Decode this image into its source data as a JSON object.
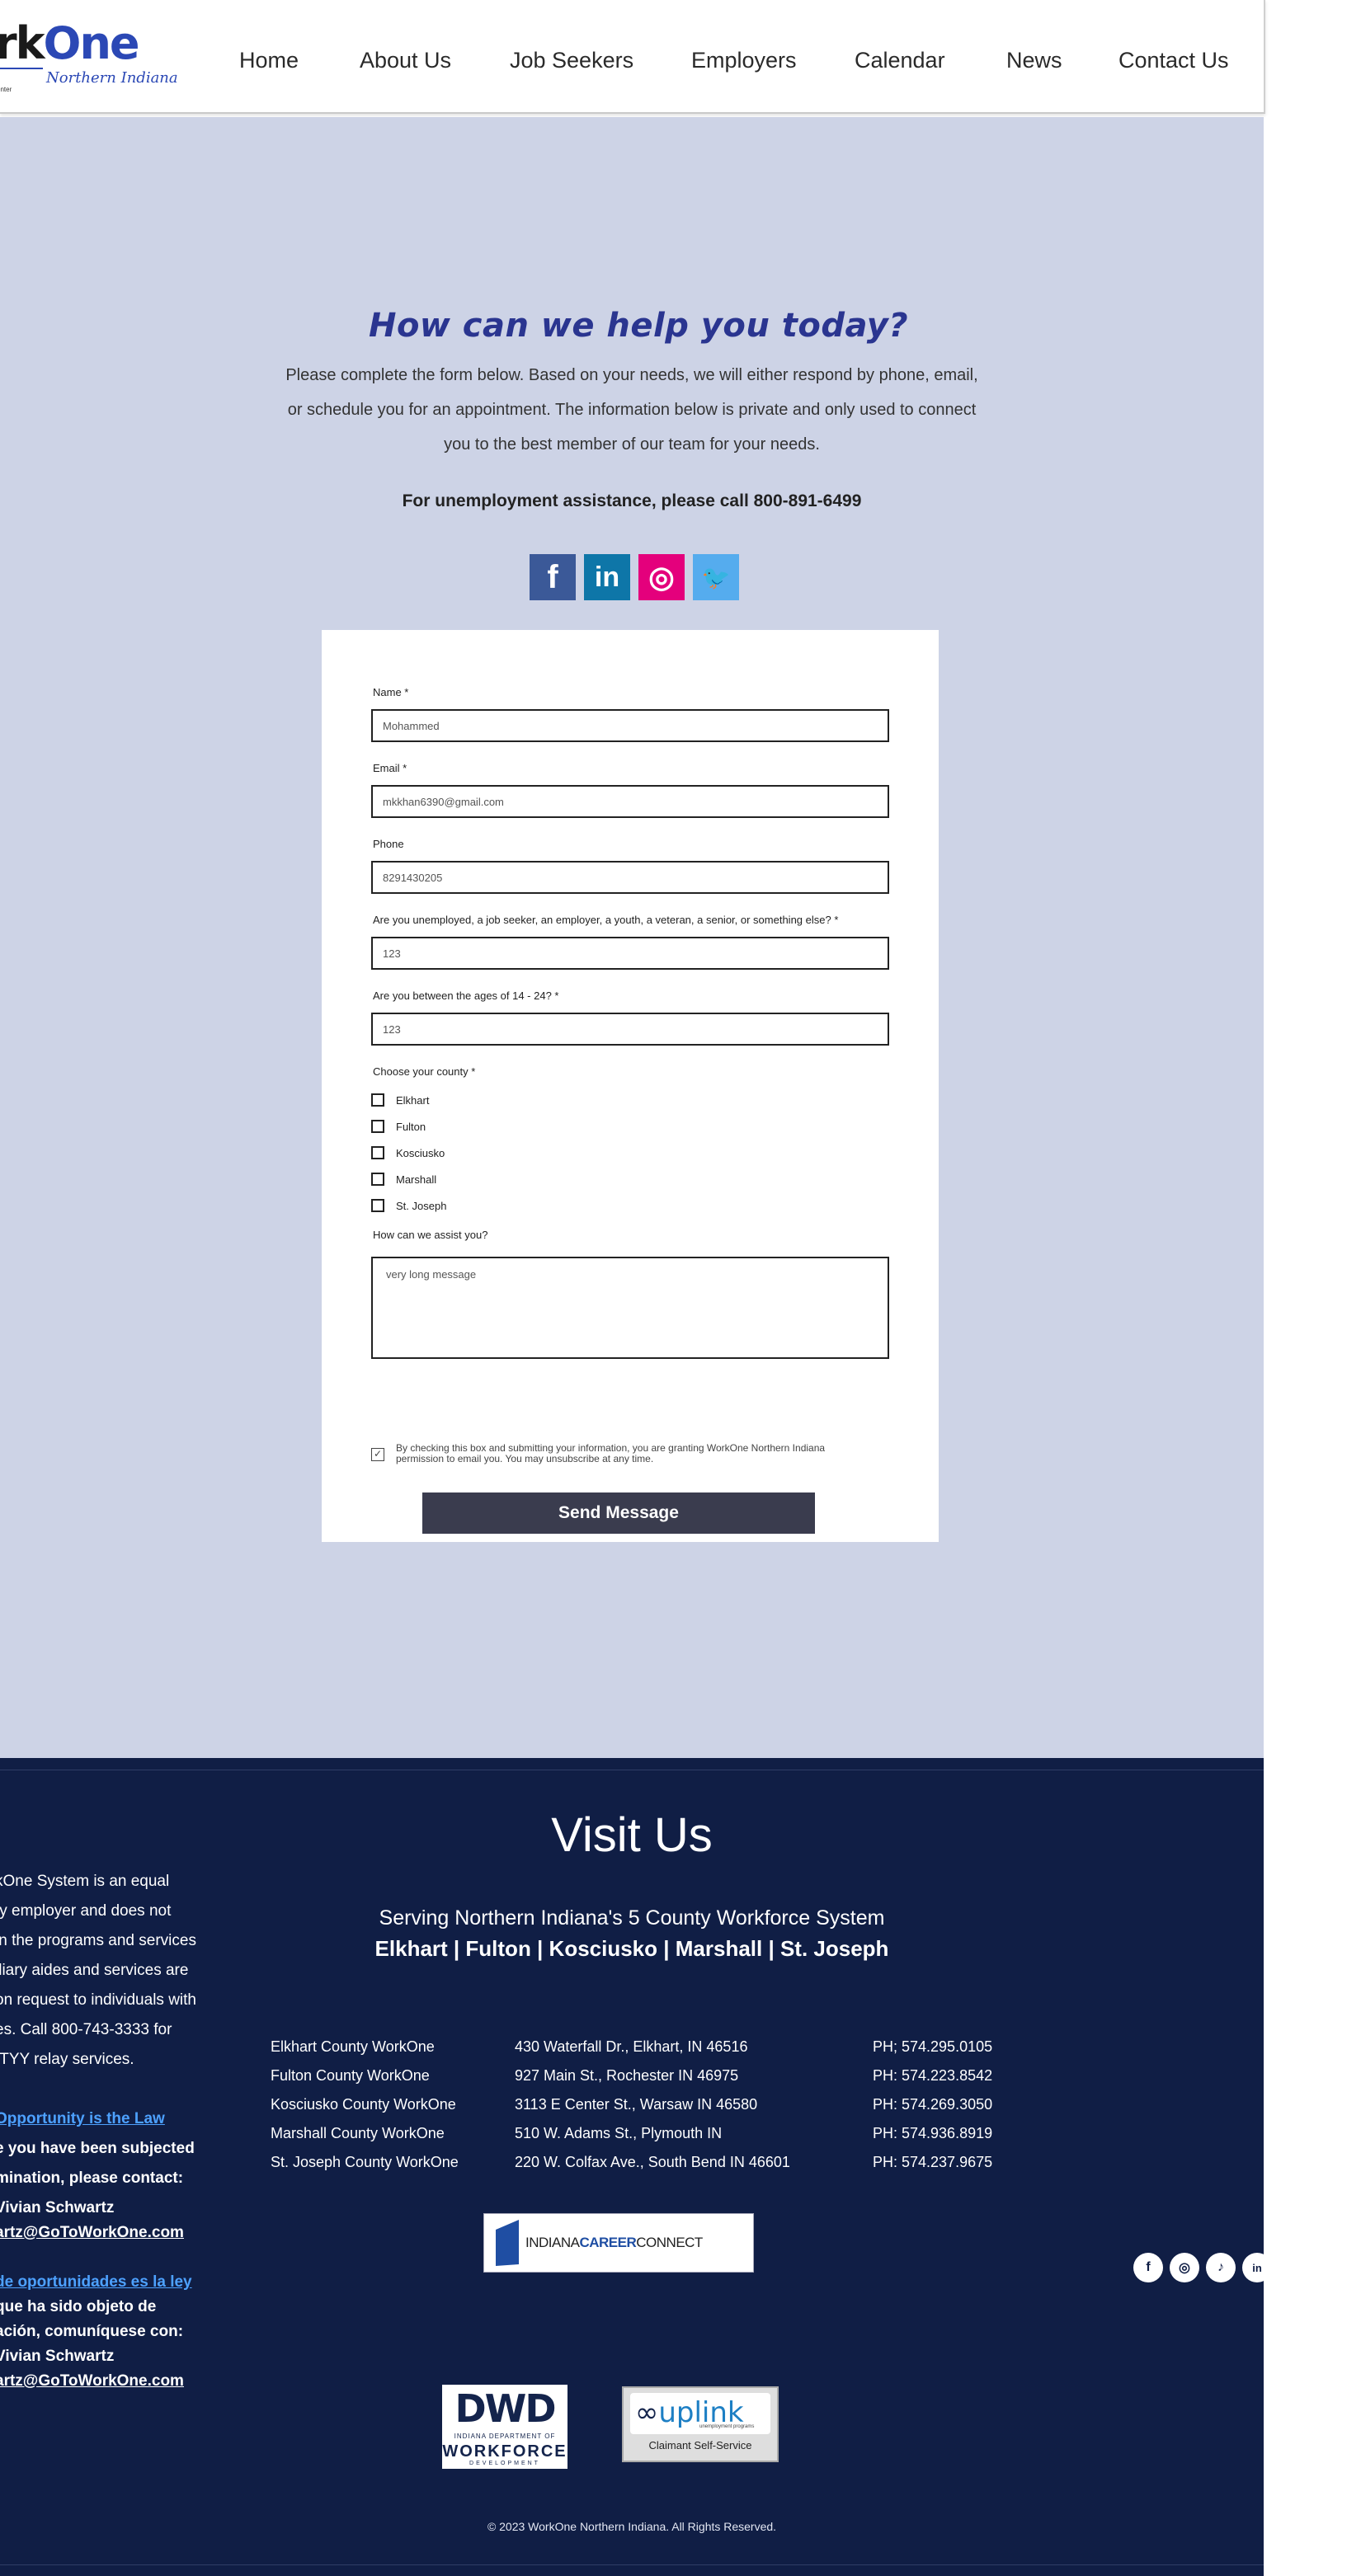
{
  "header": {
    "logo_prefix": "rk",
    "logo_suffix": "One",
    "logo_region": "Northern Indiana",
    "logo_tagline": "enter",
    "nav": [
      "Home",
      "About Us",
      "Job Seekers",
      "Employers",
      "Calendar",
      "News",
      "Contact Us"
    ]
  },
  "hero": {
    "title": "How can we help you today?",
    "intro": [
      "Please complete the form below.  Based on your needs, we will either respond by phone, email,",
      "or schedule you for an appointment. The information below is private and only used to connect",
      "you to the best member of our team for your needs."
    ],
    "unemployment_line": "For unemployment assistance, please call 800-891-6499",
    "social": [
      {
        "icon": "facebook-icon",
        "glyph": "f",
        "color": "#3b5998"
      },
      {
        "icon": "linkedin-icon",
        "glyph": "in",
        "color": "#0e76a8"
      },
      {
        "icon": "instagram-icon",
        "glyph": "◎",
        "color": "#e4007c"
      },
      {
        "icon": "twitter-icon",
        "glyph": "🐦",
        "color": "#55acee"
      }
    ]
  },
  "form": {
    "name_label": "Name *",
    "name_value": "Mohammed",
    "email_label": "Email *",
    "email_value": "mkkhan6390@gmail.com",
    "phone_label": "Phone",
    "phone_value": "8291430205",
    "status_label": "Are you unemployed, a job seeker, an employer, a youth, a veteran, a senior, or something else? *",
    "status_value": "123",
    "age_label": "Are you between the ages of 14 - 24? *",
    "age_value": "123",
    "county_label": "Choose your county *",
    "counties": [
      "Elkhart",
      "Fulton",
      "Kosciusko",
      "Marshall",
      "St. Joseph"
    ],
    "assist_label": "How can we assist you?",
    "assist_value": "very long message",
    "consent_text": "By checking this box and submitting your information, you are granting WorkOne Northern Indiana permission to email you. You may unsubscribe at any time.",
    "consent_checked": true,
    "submit_label": "Send Message"
  },
  "footer": {
    "visit_title": "Visit Us",
    "serving": "Serving Northern Indiana's 5 County Workforce System",
    "counties_line": "Elkhart | Fulton | Kosciusko | Marshall | St. Joseph",
    "offices": [
      {
        "name": "Elkhart County WorkOne",
        "address": "430 Waterfall Dr., Elkhart, IN  46516",
        "phone": "PH; 574.295.0105"
      },
      {
        "name": "Fulton County WorkOne",
        "address": "927 Main St., Rochester IN 46975",
        "phone": "PH: 574.223.8542"
      },
      {
        "name": "Kosciusko County WorkOne",
        "address": "3113 E Center St., Warsaw IN 46580",
        "phone": "PH: 574.269.3050"
      },
      {
        "name": "Marshall County WorkOne",
        "address": " 510 W. Adams St., Plymouth IN",
        "phone": "PH: 574.936.8919"
      },
      {
        "name": "St. Joseph County WorkOne",
        "address": " 220 W. Colfax Ave., South Bend IN 46601",
        "phone": " PH: 574.237.9675"
      }
    ],
    "equal_opportunity": [
      "kOne System is an equal",
      "ty employer and does not",
      "in the programs and services",
      "iliary aides and services are",
      "on request to individuals with",
      "es. Call 800-743-3333 for",
      "/TYY relay services."
    ],
    "eo_link": "Opportunity is the Law",
    "eo_lines": [
      "e you have been subjected",
      "mination, please contact:",
      "Vivian Schwartz"
    ],
    "eo_email": "artz@GoToWorkOne.com",
    "es_link": " de oportunidades es la ley",
    "es_lines": [
      " que ha sido objeto de",
      "ación, comuníquese con:",
      "Vivian Schwartz"
    ],
    "es_email": "artz@GoToWorkOne.com",
    "icc_logo_a": "INDIANA",
    "icc_logo_b": "CAREER",
    "icc_logo_c": "CONNECT",
    "dwd_logo_big": "DWD",
    "dwd_logo_small": "INDIANA DEPARTMENT OF",
    "dwd_logo_word": "WORKFORCE",
    "dwd_logo_dev": "DEVELOPMENT",
    "uplink_logo_word": "uplink",
    "uplink_logo_sub": "unemployment programs",
    "uplink_logo_label": "Claimant Self-Service",
    "social": [
      {
        "icon": "facebook-icon",
        "glyph": "f"
      },
      {
        "icon": "instagram-icon",
        "glyph": "◎"
      },
      {
        "icon": "tiktok-icon",
        "glyph": "♪"
      },
      {
        "icon": "linkedin-icon",
        "glyph": "in"
      }
    ],
    "copyright": "© 2023 WorkOne Northern Indiana. All Rights Reserved."
  },
  "colors": {
    "main_bg": "#cdd3e6",
    "footer_bg": "#101e45",
    "title_blue": "#2a3590",
    "button": "#3a3c4e",
    "link": "#4da1ff"
  }
}
